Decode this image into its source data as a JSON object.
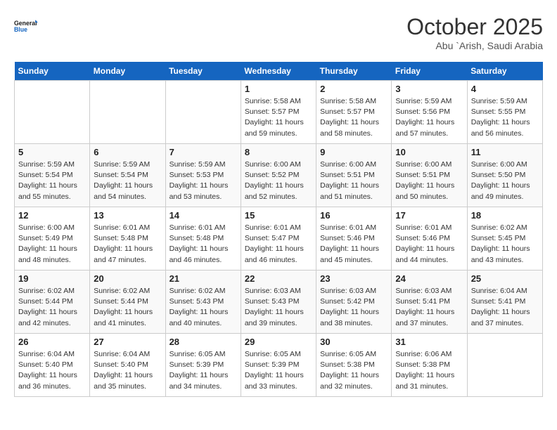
{
  "logo": {
    "line1": "General",
    "line2": "Blue"
  },
  "title": "October 2025",
  "subtitle": "Abu `Arish, Saudi Arabia",
  "days_header": [
    "Sunday",
    "Monday",
    "Tuesday",
    "Wednesday",
    "Thursday",
    "Friday",
    "Saturday"
  ],
  "weeks": [
    [
      {
        "day": "",
        "info": ""
      },
      {
        "day": "",
        "info": ""
      },
      {
        "day": "",
        "info": ""
      },
      {
        "day": "1",
        "info": "Sunrise: 5:58 AM\nSunset: 5:57 PM\nDaylight: 11 hours and 59 minutes."
      },
      {
        "day": "2",
        "info": "Sunrise: 5:58 AM\nSunset: 5:57 PM\nDaylight: 11 hours and 58 minutes."
      },
      {
        "day": "3",
        "info": "Sunrise: 5:59 AM\nSunset: 5:56 PM\nDaylight: 11 hours and 57 minutes."
      },
      {
        "day": "4",
        "info": "Sunrise: 5:59 AM\nSunset: 5:55 PM\nDaylight: 11 hours and 56 minutes."
      }
    ],
    [
      {
        "day": "5",
        "info": "Sunrise: 5:59 AM\nSunset: 5:54 PM\nDaylight: 11 hours and 55 minutes."
      },
      {
        "day": "6",
        "info": "Sunrise: 5:59 AM\nSunset: 5:54 PM\nDaylight: 11 hours and 54 minutes."
      },
      {
        "day": "7",
        "info": "Sunrise: 5:59 AM\nSunset: 5:53 PM\nDaylight: 11 hours and 53 minutes."
      },
      {
        "day": "8",
        "info": "Sunrise: 6:00 AM\nSunset: 5:52 PM\nDaylight: 11 hours and 52 minutes."
      },
      {
        "day": "9",
        "info": "Sunrise: 6:00 AM\nSunset: 5:51 PM\nDaylight: 11 hours and 51 minutes."
      },
      {
        "day": "10",
        "info": "Sunrise: 6:00 AM\nSunset: 5:51 PM\nDaylight: 11 hours and 50 minutes."
      },
      {
        "day": "11",
        "info": "Sunrise: 6:00 AM\nSunset: 5:50 PM\nDaylight: 11 hours and 49 minutes."
      }
    ],
    [
      {
        "day": "12",
        "info": "Sunrise: 6:00 AM\nSunset: 5:49 PM\nDaylight: 11 hours and 48 minutes."
      },
      {
        "day": "13",
        "info": "Sunrise: 6:01 AM\nSunset: 5:48 PM\nDaylight: 11 hours and 47 minutes."
      },
      {
        "day": "14",
        "info": "Sunrise: 6:01 AM\nSunset: 5:48 PM\nDaylight: 11 hours and 46 minutes."
      },
      {
        "day": "15",
        "info": "Sunrise: 6:01 AM\nSunset: 5:47 PM\nDaylight: 11 hours and 46 minutes."
      },
      {
        "day": "16",
        "info": "Sunrise: 6:01 AM\nSunset: 5:46 PM\nDaylight: 11 hours and 45 minutes."
      },
      {
        "day": "17",
        "info": "Sunrise: 6:01 AM\nSunset: 5:46 PM\nDaylight: 11 hours and 44 minutes."
      },
      {
        "day": "18",
        "info": "Sunrise: 6:02 AM\nSunset: 5:45 PM\nDaylight: 11 hours and 43 minutes."
      }
    ],
    [
      {
        "day": "19",
        "info": "Sunrise: 6:02 AM\nSunset: 5:44 PM\nDaylight: 11 hours and 42 minutes."
      },
      {
        "day": "20",
        "info": "Sunrise: 6:02 AM\nSunset: 5:44 PM\nDaylight: 11 hours and 41 minutes."
      },
      {
        "day": "21",
        "info": "Sunrise: 6:02 AM\nSunset: 5:43 PM\nDaylight: 11 hours and 40 minutes."
      },
      {
        "day": "22",
        "info": "Sunrise: 6:03 AM\nSunset: 5:43 PM\nDaylight: 11 hours and 39 minutes."
      },
      {
        "day": "23",
        "info": "Sunrise: 6:03 AM\nSunset: 5:42 PM\nDaylight: 11 hours and 38 minutes."
      },
      {
        "day": "24",
        "info": "Sunrise: 6:03 AM\nSunset: 5:41 PM\nDaylight: 11 hours and 37 minutes."
      },
      {
        "day": "25",
        "info": "Sunrise: 6:04 AM\nSunset: 5:41 PM\nDaylight: 11 hours and 37 minutes."
      }
    ],
    [
      {
        "day": "26",
        "info": "Sunrise: 6:04 AM\nSunset: 5:40 PM\nDaylight: 11 hours and 36 minutes."
      },
      {
        "day": "27",
        "info": "Sunrise: 6:04 AM\nSunset: 5:40 PM\nDaylight: 11 hours and 35 minutes."
      },
      {
        "day": "28",
        "info": "Sunrise: 6:05 AM\nSunset: 5:39 PM\nDaylight: 11 hours and 34 minutes."
      },
      {
        "day": "29",
        "info": "Sunrise: 6:05 AM\nSunset: 5:39 PM\nDaylight: 11 hours and 33 minutes."
      },
      {
        "day": "30",
        "info": "Sunrise: 6:05 AM\nSunset: 5:38 PM\nDaylight: 11 hours and 32 minutes."
      },
      {
        "day": "31",
        "info": "Sunrise: 6:06 AM\nSunset: 5:38 PM\nDaylight: 11 hours and 31 minutes."
      },
      {
        "day": "",
        "info": ""
      }
    ]
  ]
}
